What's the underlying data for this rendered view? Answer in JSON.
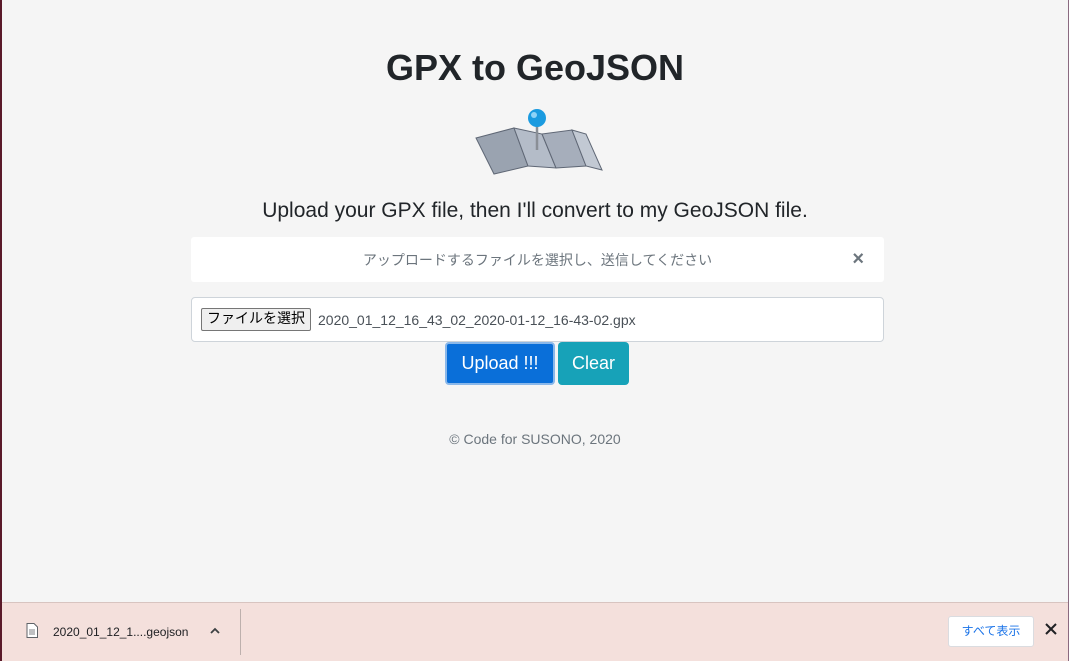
{
  "header": {
    "title": "GPX to GeoJSON",
    "subtitle": "Upload your GPX file, then I'll convert to my GeoJSON file."
  },
  "alert": {
    "message": "アップロードするファイルを選択し、送信してください",
    "close_symbol": "×"
  },
  "file_input": {
    "button_label": "ファイルを選択",
    "selected_file": "2020_01_12_16_43_02_2020-01-12_16-43-02.gpx"
  },
  "actions": {
    "upload_label": "Upload !!!",
    "clear_label": "Clear"
  },
  "footer": {
    "text": "© Code for SUSONO, 2020"
  },
  "download_shelf": {
    "file_name": "2020_01_12_1....geojson",
    "show_all_label": "すべて表示",
    "icons": [
      "document-icon",
      "chevron-up-icon",
      "close-icon"
    ]
  },
  "colors": {
    "background": "#f5f5f5",
    "upload_button": "#0a6fd9",
    "clear_button": "#17a2b8",
    "shelf_background": "#f4e0dc",
    "link_blue": "#1a73e8"
  },
  "icons": {
    "map": "folded-map-with-pin-icon"
  }
}
